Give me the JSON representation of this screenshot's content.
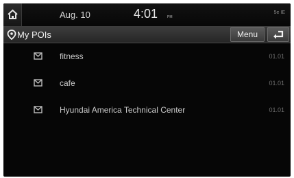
{
  "status_bar": {
    "date": "Aug. 10",
    "time": "4:01",
    "ampm": "PM",
    "icons_text": "5e IE"
  },
  "header": {
    "title": "My POIs",
    "menu_label": "Menu"
  },
  "icons": {
    "home": "home-icon",
    "pin": "location-pin-icon",
    "back": "back-arrow-icon",
    "poi": "envelope-icon"
  },
  "poi_list": [
    {
      "name": "fitness",
      "code": "01.01"
    },
    {
      "name": "cafe",
      "code": "01.01"
    },
    {
      "name": "Hyundai America Technical Center",
      "code": "01.01"
    }
  ]
}
